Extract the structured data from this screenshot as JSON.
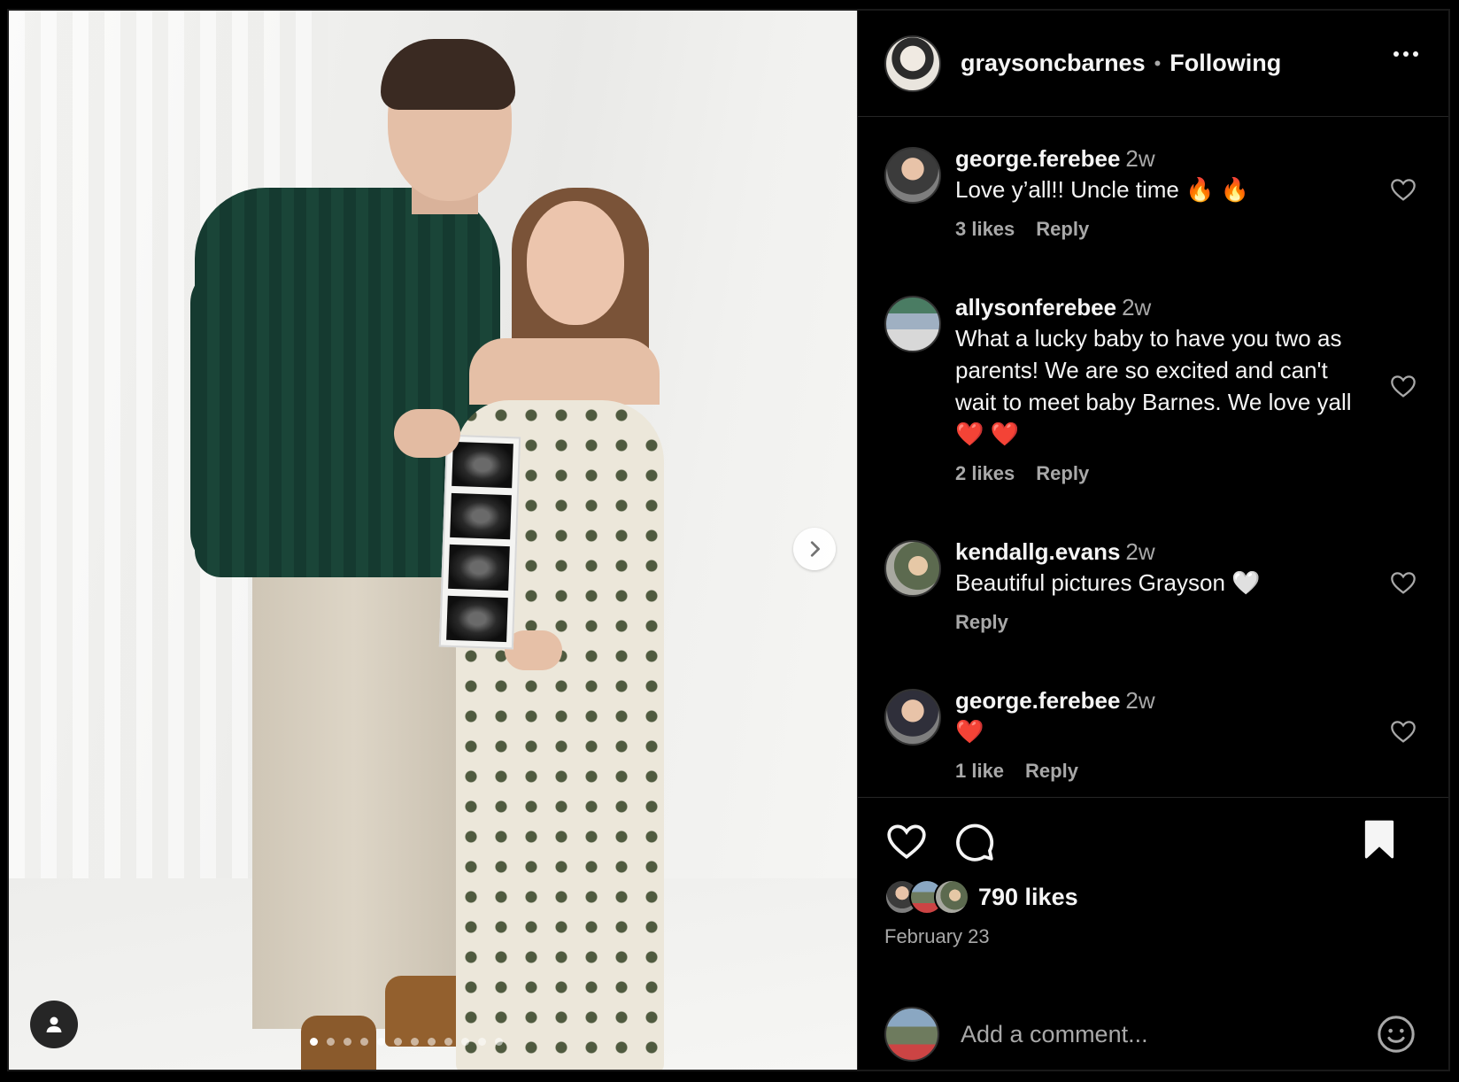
{
  "post": {
    "author": "graysoncbarnes",
    "separator": "•",
    "follow_status": "Following",
    "carousel": {
      "slide_count": 12,
      "active_slide": 1
    }
  },
  "comments": [
    {
      "author": "george.ferebee",
      "time": "2w",
      "text": "Love y’all!! Uncle time 🔥 🔥",
      "likes": "3 likes",
      "reply": "Reply"
    },
    {
      "author": "allysonferebee",
      "time": "2w",
      "text": "What a lucky baby to have you two as parents! We are so excited and can't wait to meet baby Barnes. We love yall❤️ ❤️",
      "likes": "2 likes",
      "reply": "Reply"
    },
    {
      "author": "kendallg.evans",
      "time": "2w",
      "text": "Beautiful pictures Grayson 🤍",
      "likes": "",
      "reply": "Reply"
    },
    {
      "author": "george.ferebee",
      "time": "2w",
      "text": "❤️",
      "likes": "1 like",
      "reply": "Reply"
    }
  ],
  "actions": {
    "likes": "790 likes",
    "date": "February 23",
    "comment_placeholder": "Add a comment..."
  },
  "icons": [
    "more-icon",
    "heart-icon",
    "comment-icon",
    "bookmark-icon",
    "chevron-right-icon",
    "user-tag-icon",
    "emoji-icon"
  ]
}
